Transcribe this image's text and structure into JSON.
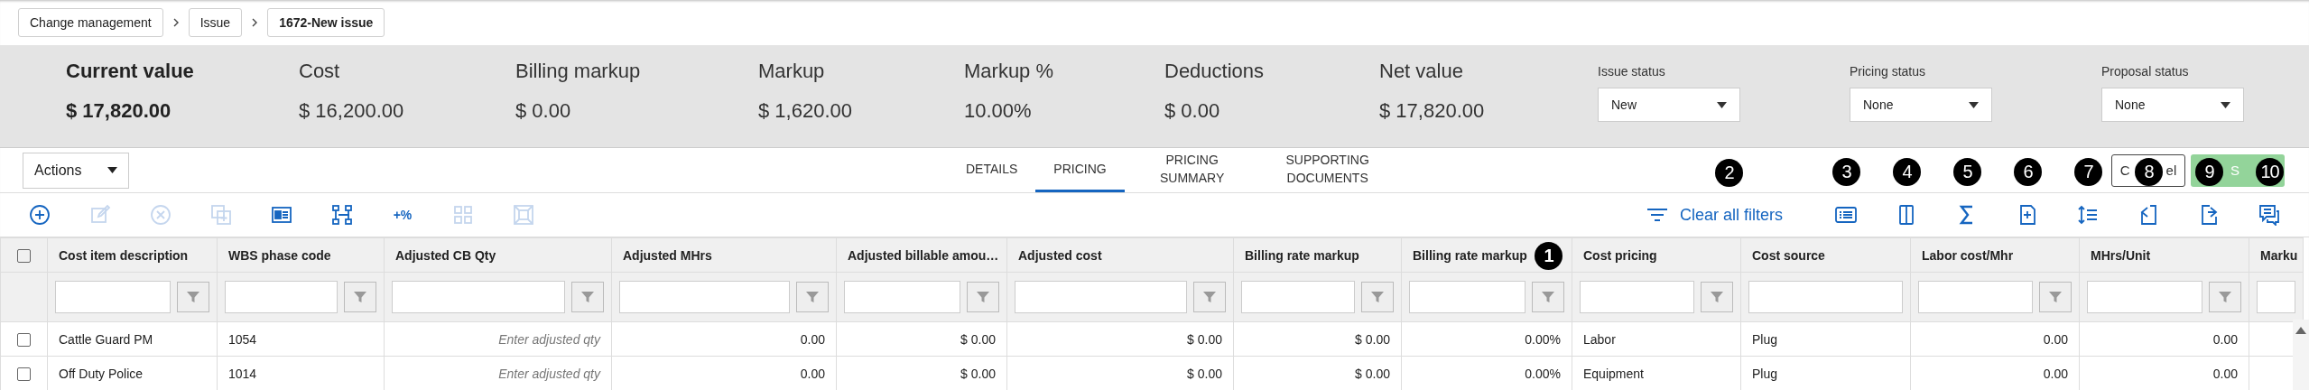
{
  "breadcrumbs": [
    {
      "label": "Change management",
      "current": false
    },
    {
      "label": "Issue",
      "current": false
    },
    {
      "label": "1672-New issue",
      "current": true
    }
  ],
  "summary": [
    {
      "label": "Current value",
      "value": "$ 17,820.00",
      "emphasized": true
    },
    {
      "label": "Cost",
      "value": "$ 16,200.00",
      "emphasized": false
    },
    {
      "label": "Billing markup",
      "value": "$ 0.00",
      "emphasized": false
    },
    {
      "label": "Markup",
      "value": "$ 1,620.00",
      "emphasized": false
    },
    {
      "label": "Markup %",
      "value": "10.00%",
      "emphasized": false
    },
    {
      "label": "Deductions",
      "value": "$ 0.00",
      "emphasized": false
    },
    {
      "label": "Net value",
      "value": "$ 17,820.00",
      "emphasized": false
    }
  ],
  "statuses": [
    {
      "label": "Issue status",
      "value": "New"
    },
    {
      "label": "Pricing status",
      "value": "None"
    },
    {
      "label": "Proposal status",
      "value": "None"
    }
  ],
  "actions": {
    "value": "Actions"
  },
  "tabs": [
    {
      "label": "DETAILS",
      "selected": false
    },
    {
      "label": "PRICING",
      "selected": true
    },
    {
      "label": "PRICING SUMMARY",
      "selected": false
    },
    {
      "label": "SUPPORTING DOCUMENTS",
      "selected": false
    }
  ],
  "buttons": [
    {
      "visible_text": [
        "C",
        "el"
      ],
      "kind": "secondary"
    },
    {
      "visible_text": [
        "S"
      ],
      "kind": "primary",
      "disabled": true
    }
  ],
  "left_tools": [
    {
      "kind": "add",
      "disabled": false
    },
    {
      "kind": "edit",
      "disabled": true
    },
    {
      "kind": "remove",
      "disabled": true
    },
    {
      "kind": "copy",
      "disabled": true
    },
    {
      "kind": "card",
      "disabled": false
    },
    {
      "kind": "hierarchy",
      "disabled": false
    },
    {
      "kind": "percent",
      "disabled": false,
      "label": "+%"
    },
    {
      "kind": "grid",
      "disabled": true
    },
    {
      "kind": "frame",
      "disabled": true
    }
  ],
  "clear_filters": {
    "label": "Clear all filters",
    "callout": "2"
  },
  "right_tools": [
    {
      "kind": "list",
      "callout": "3"
    },
    {
      "kind": "columns",
      "callout": "4"
    },
    {
      "kind": "sum",
      "callout": "5"
    },
    {
      "kind": "add-note",
      "callout": "6"
    },
    {
      "kind": "spacing",
      "callout": "7"
    },
    {
      "kind": "import",
      "callout": "8"
    },
    {
      "kind": "export",
      "callout": "9"
    },
    {
      "kind": "comment",
      "callout": "10"
    }
  ],
  "table": {
    "select_all_checked": false,
    "columns": [
      {
        "label": "Cost item description",
        "kind": "text",
        "filter_button": true
      },
      {
        "label": "WBS phase code",
        "kind": "text",
        "filter_button": true
      },
      {
        "label": "Adjusted CB Qty",
        "kind": "entry",
        "filter_button": true
      },
      {
        "label": "Adjusted MHrs",
        "kind": "number",
        "filter_button": true
      },
      {
        "label": "Adjusted billable amou…",
        "kind": "number",
        "filter_button": true
      },
      {
        "label": "Adjusted cost",
        "kind": "number",
        "filter_button": true
      },
      {
        "label": "Billing rate markup",
        "kind": "number",
        "filter_button": true
      },
      {
        "label": "Billing rate markup",
        "kind": "number",
        "filter_button": true,
        "callout": "1"
      },
      {
        "label": "Cost pricing",
        "kind": "text",
        "filter_button": true
      },
      {
        "label": "Cost source",
        "kind": "text",
        "filter_button": false
      },
      {
        "label": "Labor cost/Mhr",
        "kind": "number",
        "filter_button": true
      },
      {
        "label": "MHrs/Unit",
        "kind": "number",
        "filter_button": true
      },
      {
        "label": "Marku",
        "kind": "number",
        "filter_button": false
      }
    ],
    "rows": [
      {
        "checked": false,
        "cells": [
          "Cattle Guard PM",
          "1054",
          "Enter adjusted qty",
          "0.00",
          "$ 0.00",
          "$ 0.00",
          "$ 0.00",
          "0.00%",
          "Labor",
          "Plug",
          "0.00",
          "0.00"
        ]
      },
      {
        "checked": false,
        "cells": [
          "Off Duty Police",
          "1014",
          "Enter adjusted qty",
          "0.00",
          "$ 0.00",
          "$ 0.00",
          "$ 0.00",
          "0.00%",
          "Equipment",
          "Plug",
          "0.00",
          "0.00"
        ]
      }
    ]
  }
}
